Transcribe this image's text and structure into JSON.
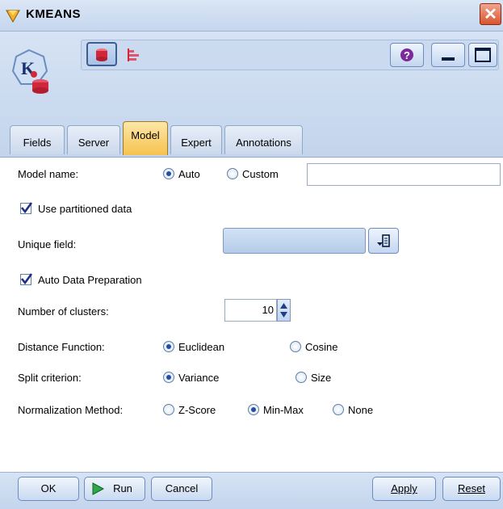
{
  "window": {
    "title": "KMEANS",
    "close_glyph": "✕"
  },
  "tabs": [
    {
      "label": "Fields"
    },
    {
      "label": "Server"
    },
    {
      "label": "Model"
    },
    {
      "label": "Expert"
    },
    {
      "label": "Annotations"
    }
  ],
  "model": {
    "model_name_label": "Model name:",
    "auto_label": "Auto",
    "custom_label": "Custom",
    "custom_value": "",
    "model_name_selected": "Auto",
    "use_partitioned_label": "Use partitioned data",
    "use_partitioned_checked": true,
    "unique_field_label": "Unique field:",
    "unique_field_value": "",
    "auto_prep_label": "Auto Data Preparation",
    "auto_prep_checked": true,
    "num_clusters_label": "Number of clusters:",
    "num_clusters_value": "10",
    "distance_label": "Distance Function:",
    "distance_options": [
      "Euclidean",
      "Cosine"
    ],
    "distance_selected": "Euclidean",
    "split_label": "Split criterion:",
    "split_options": [
      "Variance",
      "Size"
    ],
    "split_selected": "Variance",
    "norm_label": "Normalization Method:",
    "norm_options": [
      "Z-Score",
      "Min-Max",
      "None"
    ],
    "norm_selected": "Min-Max"
  },
  "footer": {
    "ok": "OK",
    "run": "Run",
    "cancel": "Cancel",
    "apply": "Apply",
    "reset": "Reset"
  },
  "icons": {
    "help": "help-icon",
    "minimize": "minimize-icon",
    "maximize": "maximize-icon",
    "database": "database-icon",
    "chart": "bar-chart-icon"
  },
  "colors": {
    "active_tab": "#f6c24d",
    "chrome": "#c9daf0"
  }
}
